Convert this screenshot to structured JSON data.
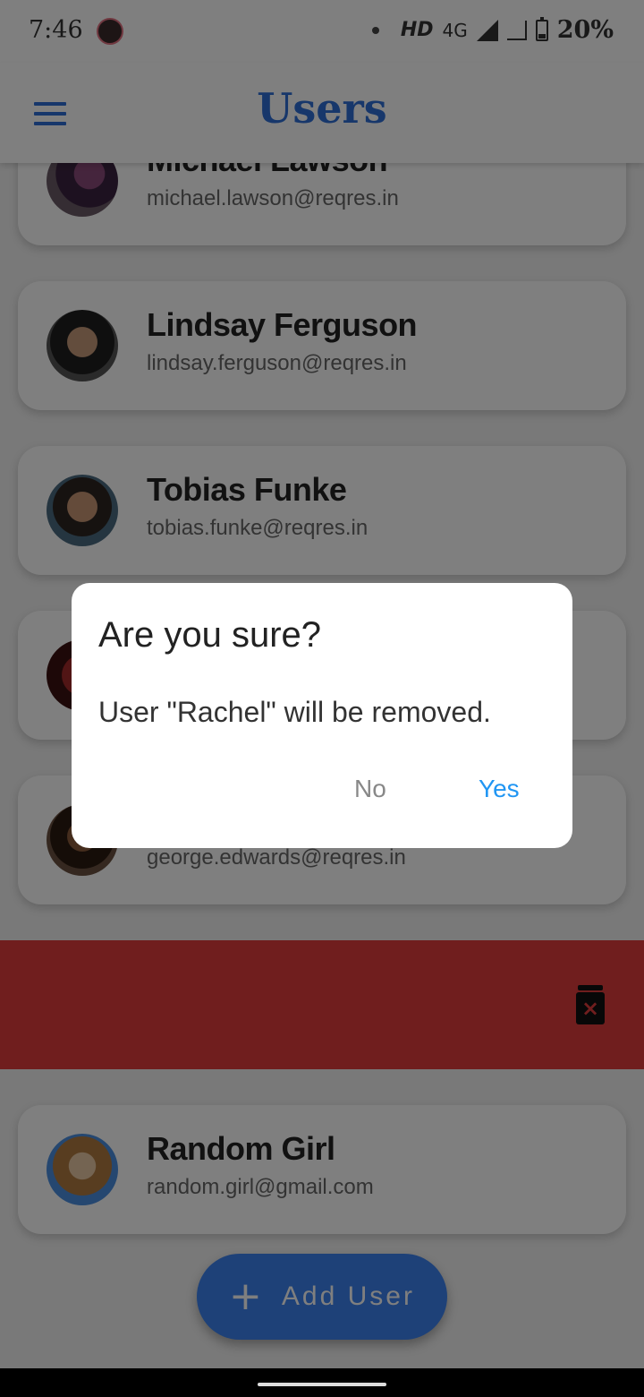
{
  "status_bar": {
    "time": "7:46",
    "hd": "HD",
    "network": "4G",
    "battery": "20%"
  },
  "app_bar": {
    "title": "Users"
  },
  "users": [
    {
      "name": "Michael Lawson",
      "email": "michael.lawson@reqres.in"
    },
    {
      "name": "Lindsay Ferguson",
      "email": "lindsay.ferguson@reqres.in"
    },
    {
      "name": "Tobias Funke",
      "email": "tobias.funke@reqres.in"
    },
    {
      "name": "",
      "email": ""
    },
    {
      "name": "",
      "email": "george.edwards@reqres.in"
    },
    {
      "name": "Random Girl",
      "email": "random.girl@gmail.com"
    }
  ],
  "dialog": {
    "title": "Are you sure?",
    "message": "User \"Rachel\" will be removed.",
    "no_label": "No",
    "yes_label": "Yes"
  },
  "fab": {
    "icon": "+",
    "label": "Add User"
  },
  "colors": {
    "primary": "#2f6fd6",
    "delete_background": "#e03c3c",
    "dialog_accent": "#2196f3"
  }
}
